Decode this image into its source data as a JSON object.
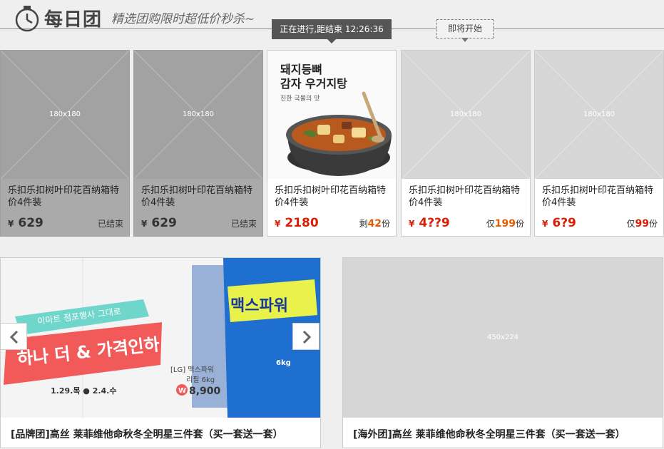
{
  "header": {
    "logo_text": "每日团",
    "slogan": "精选团购限时超低价秒杀~",
    "timer_text": "正在进行,距结束 12:26:36",
    "upcoming_text": "即将开始"
  },
  "products": [
    {
      "name": "乐扣乐扣树叶印花百纳箱特价4件装",
      "currency": "¥",
      "price": "629",
      "status_text": "已结束",
      "placeholder": "180x180"
    },
    {
      "name": "乐扣乐扣树叶印花百纳箱特价4件装",
      "currency": "¥",
      "price": "629",
      "status_text": "已结束",
      "placeholder": "180x180"
    },
    {
      "name": "乐扣乐扣树叶印花百纳箱特价4件装",
      "currency": "¥",
      "price": "2180",
      "status_prefix": "剩",
      "status_count": "42",
      "status_suffix": "份",
      "image_text": {
        "line1": "돼지등뼈",
        "line2": "감자 우거지탕",
        "line3": "진한 국물의 맛"
      }
    },
    {
      "name": "乐扣乐扣树叶印花百纳箱特价4件装",
      "currency": "¥",
      "price": "4??9",
      "status_prefix": "仅",
      "status_count": "199",
      "status_suffix": "份",
      "placeholder": "180x180"
    },
    {
      "name": "乐扣乐扣树叶印花百纳箱特价4件装",
      "currency": "¥",
      "price": "6?9",
      "status_prefix": "仅",
      "status_count": "99",
      "status_suffix": "份",
      "placeholder": "180x180"
    }
  ],
  "banners": [
    {
      "title": "[品牌团]高丝 莱菲维他命秋冬全明星三件套（买一套送一套）",
      "image_text": {
        "ribbon": "이마트 점포행사 그대로",
        "headline": "하나 더 & 가격인하",
        "dates": "1.29.목 ● 2.4.수",
        "product": "[LG] 맥스파워",
        "product2": "리필 6kg",
        "price": "8,900",
        "won": "W",
        "pack_brand": "맥스파워",
        "pack_size": "6kg"
      }
    },
    {
      "title": "[海外团]高丝 莱菲维他命秋冬全明星三件套（买一套送一套）",
      "placeholder": "450x224"
    }
  ],
  "colors": {
    "accent": "#d81e06",
    "count": "#e65c00",
    "dark_badge": "#555555"
  }
}
